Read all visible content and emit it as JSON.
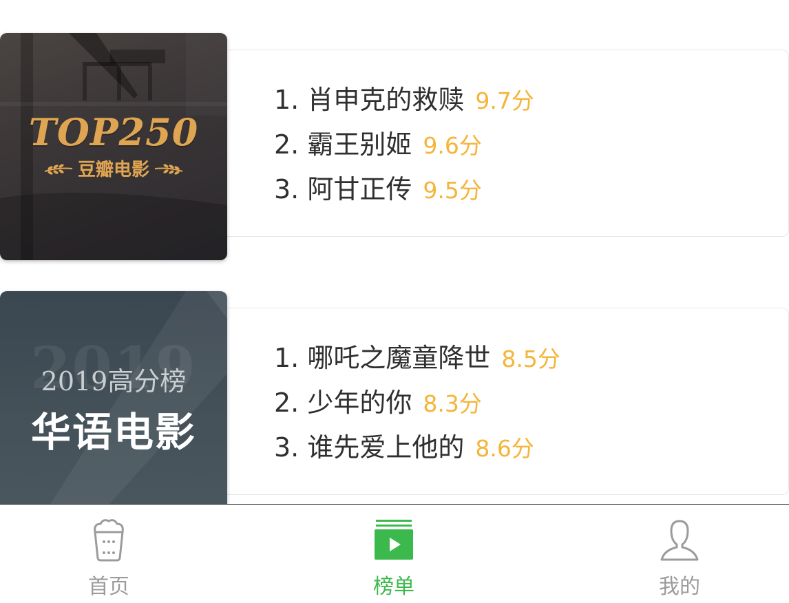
{
  "charts": [
    {
      "cover": {
        "title": "TOP250",
        "subtitle": "豆瓣电影"
      },
      "movies": [
        {
          "name": "1. 肖申克的救赎",
          "score": "9.7分"
        },
        {
          "name": "2. 霸王别姬",
          "score": "9.6分"
        },
        {
          "name": "3. 阿甘正传",
          "score": "9.5分"
        }
      ]
    },
    {
      "cover": {
        "year_watermark": "2019",
        "subtitle": "2019高分榜",
        "title": "华语电影"
      },
      "movies": [
        {
          "name": "1. 哪吒之魔童降世",
          "score": "8.5分"
        },
        {
          "name": "2. 少年的你",
          "score": "8.3分"
        },
        {
          "name": "3. 谁先爱上他的",
          "score": "8.6分"
        }
      ]
    }
  ],
  "tabbar": {
    "tabs": [
      {
        "label": "首页",
        "icon": "popcorn-icon",
        "active": false
      },
      {
        "label": "榜单",
        "icon": "ranking-list-icon",
        "active": true
      },
      {
        "label": "我的",
        "icon": "person-icon",
        "active": false
      }
    ]
  },
  "colors": {
    "score": "#f4b53a",
    "tab_active": "#3cb94d",
    "tab_inactive": "#9b9b9b",
    "gold": "#e0a552"
  }
}
